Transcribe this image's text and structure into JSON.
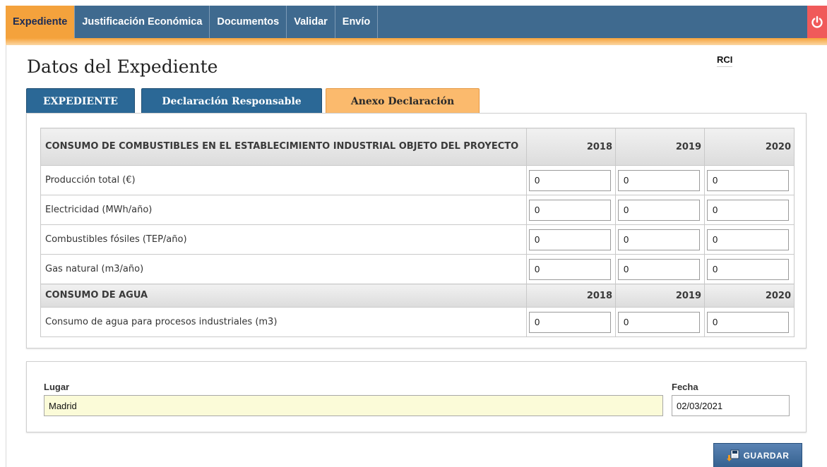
{
  "nav": {
    "items": [
      {
        "label": "Expediente",
        "active": true
      },
      {
        "label": "Justificación Económica",
        "active": false
      },
      {
        "label": "Documentos",
        "active": false
      },
      {
        "label": "Validar",
        "active": false
      },
      {
        "label": "Envío",
        "active": false
      }
    ],
    "power_icon": "power-icon",
    "accent_color": "#f4a23c",
    "bar_color": "#3f6a8f"
  },
  "page": {
    "title": "Datos del Expediente",
    "code": "RCI"
  },
  "tabs": [
    {
      "label": "EXPEDIENTE",
      "active": false
    },
    {
      "label": "Declaración Responsable",
      "active": false
    },
    {
      "label": "Anexo Declaración",
      "active": true
    }
  ],
  "table": {
    "sections": [
      {
        "title": "CONSUMO DE COMBUSTIBLES EN EL ESTABLECIMIENTO INDUSTRIAL OBJETO DEL PROYECTO",
        "years": [
          "2018",
          "2019",
          "2020"
        ],
        "rows": [
          {
            "label": "Producción total (€)",
            "values": [
              "0",
              "0",
              "0"
            ]
          },
          {
            "label": "Electricidad (MWh/año)",
            "values": [
              "0",
              "0",
              "0"
            ]
          },
          {
            "label": "Combustibles fósiles (TEP/año)",
            "values": [
              "0",
              "0",
              "0"
            ]
          },
          {
            "label": "Gas natural (m3/año)",
            "values": [
              "0",
              "0",
              "0"
            ]
          }
        ]
      },
      {
        "title": "CONSUMO DE AGUA",
        "years": [
          "2018",
          "2019",
          "2020"
        ],
        "rows": [
          {
            "label": "Consumo de agua para procesos industriales (m3)",
            "values": [
              "0",
              "0",
              "0"
            ]
          }
        ]
      }
    ]
  },
  "place": {
    "lugar_label": "Lugar",
    "lugar_value": "Madrid",
    "fecha_label": "Fecha",
    "fecha_value": "02/03/2021"
  },
  "actions": {
    "save_label": "GUARDAR",
    "save_icon": "save-icon"
  }
}
